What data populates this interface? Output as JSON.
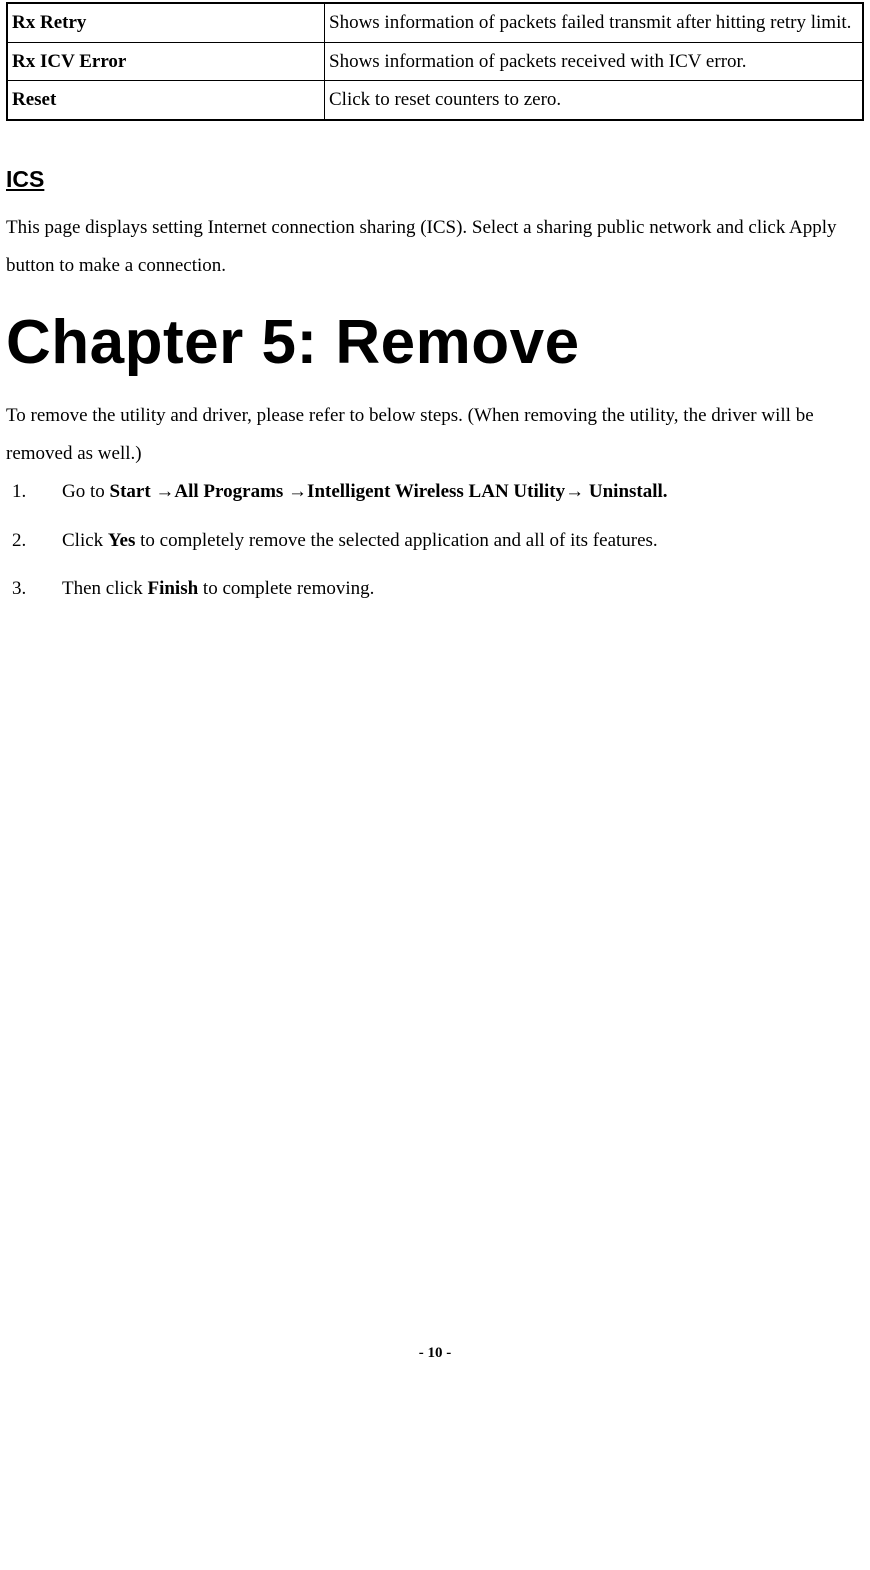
{
  "table": {
    "rows": [
      {
        "term": "Rx Retry",
        "desc": "Shows information of packets failed transmit after hitting retry limit."
      },
      {
        "term": "Rx ICV Error",
        "desc": "Shows information of packets received with ICV error."
      },
      {
        "term": "Reset",
        "desc": "Click to reset counters to zero."
      }
    ]
  },
  "ics": {
    "heading": "ICS",
    "para": "This page displays setting Internet connection sharing (ICS). Select a sharing public network and click Apply button to make a connection."
  },
  "chapter": {
    "title": "Chapter 5: Remove",
    "intro": "To remove the utility and driver, please refer to below steps. (When removing the utility, the driver will be removed as well.)"
  },
  "steps": {
    "s1_prefix": "Go to ",
    "s1_b1": "Start ",
    "s1_arrow": "→",
    "s1_b2": "All Programs ",
    "s1_b3": "Intelligent Wireless LAN Utility",
    "s1_b4": " Uninstall.",
    "s2_prefix": "Click ",
    "s2_b": "Yes",
    "s2_suffix": " to completely remove the selected application and all of its features.",
    "s3_prefix": "Then click ",
    "s3_b": "Finish",
    "s3_suffix": " to complete removing."
  },
  "footer": "- 10 -"
}
